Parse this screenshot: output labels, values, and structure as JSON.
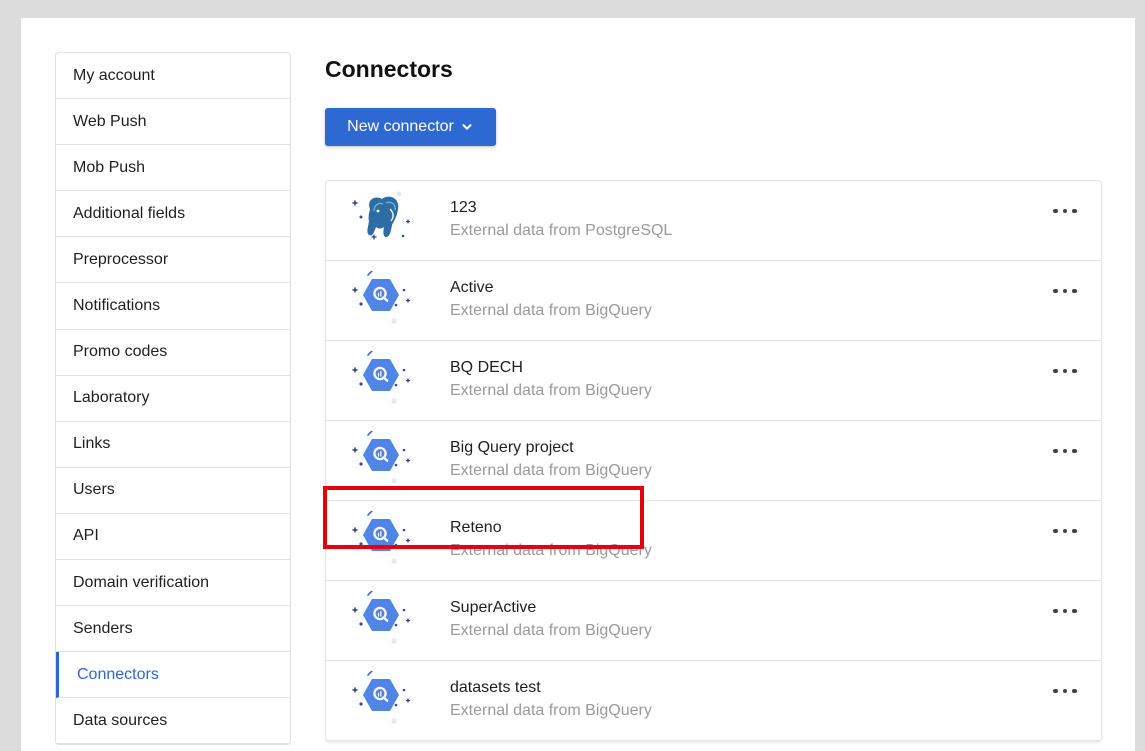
{
  "sidebar": {
    "items": [
      {
        "label": "My account",
        "active": false
      },
      {
        "label": "Web Push",
        "active": false
      },
      {
        "label": "Mob Push",
        "active": false
      },
      {
        "label": "Additional fields",
        "active": false
      },
      {
        "label": "Preprocessor",
        "active": false
      },
      {
        "label": "Notifications",
        "active": false
      },
      {
        "label": "Promo codes",
        "active": false
      },
      {
        "label": "Laboratory",
        "active": false
      },
      {
        "label": "Links",
        "active": false
      },
      {
        "label": "Users",
        "active": false
      },
      {
        "label": "API",
        "active": false
      },
      {
        "label": "Domain verification",
        "active": false
      },
      {
        "label": "Senders",
        "active": false
      },
      {
        "label": "Connectors",
        "active": true
      },
      {
        "label": "Data sources",
        "active": false
      }
    ]
  },
  "main": {
    "title": "Connectors",
    "new_button_label": "New connector",
    "connectors": [
      {
        "name": "123",
        "description": "External data from PostgreSQL",
        "icon": "postgresql-icon"
      },
      {
        "name": "Active",
        "description": "External data from BigQuery",
        "icon": "bigquery-icon"
      },
      {
        "name": "BQ DECH",
        "description": "External data from BigQuery",
        "icon": "bigquery-icon"
      },
      {
        "name": "Big Query project",
        "description": "External data from BigQuery",
        "icon": "bigquery-icon"
      },
      {
        "name": "Reteno",
        "description": "External data from BigQuery",
        "icon": "bigquery-icon",
        "highlighted": true
      },
      {
        "name": "SuperActive",
        "description": "External data from BigQuery",
        "icon": "bigquery-icon"
      },
      {
        "name": "datasets test",
        "description": "External data from BigQuery",
        "icon": "bigquery-icon"
      }
    ]
  },
  "colors": {
    "accent": "#2d68d3",
    "highlight": "#e3000f",
    "bigquery_blue": "#4e85e6",
    "postgres_blue": "#2c6ea3"
  }
}
